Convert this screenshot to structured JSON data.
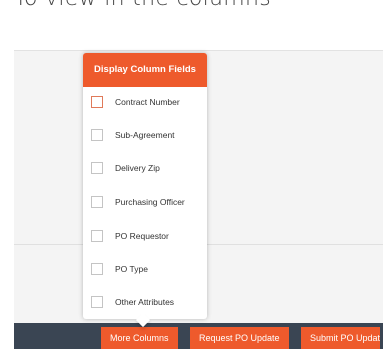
{
  "page": {
    "heading": "To view in the columns"
  },
  "popup": {
    "title": "Display Column Fields",
    "fields": [
      {
        "label": "Contract Number",
        "checked": false
      },
      {
        "label": "Sub-Agreement",
        "checked": false
      },
      {
        "label": "Delivery Zip",
        "checked": false
      },
      {
        "label": "Purchasing Officer",
        "checked": false
      },
      {
        "label": "PO Requestor",
        "checked": false
      },
      {
        "label": "PO Type",
        "checked": false
      },
      {
        "label": "Other Attributes",
        "checked": false
      }
    ]
  },
  "toolbar": {
    "more_columns": "More Columns",
    "request_po_update": "Request PO Update",
    "submit_po_update": "Submit PO Updat"
  },
  "colors": {
    "accent": "#ee5a2c",
    "toolbar_bg": "#3a4553"
  }
}
